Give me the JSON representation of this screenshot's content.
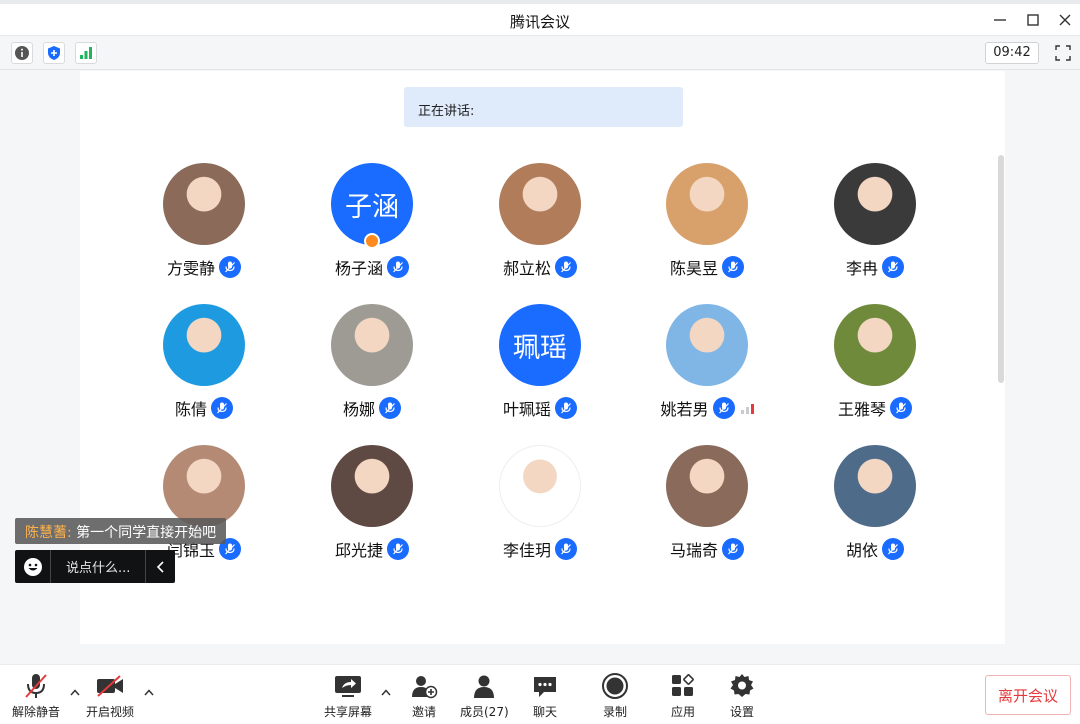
{
  "window": {
    "title": "腾讯会议"
  },
  "toolbar": {
    "clock": "09:42"
  },
  "speaking": {
    "label": "正在讲话:"
  },
  "participants": [
    {
      "name": "方雯静",
      "avatar_type": "photo",
      "avatar_color": "#8b6a5a"
    },
    {
      "name": "杨子涵",
      "avatar_type": "text",
      "avatar_text": "子涵",
      "avatar_color": "#1a6bff",
      "host": true
    },
    {
      "name": "郝立松",
      "avatar_type": "photo",
      "avatar_color": "#b07c5a"
    },
    {
      "name": "陈昊昱",
      "avatar_type": "photo",
      "avatar_color": "#d8a06a"
    },
    {
      "name": "李冉",
      "avatar_type": "photo",
      "avatar_color": "#3a3a3a"
    },
    {
      "name": "陈倩",
      "avatar_type": "photo",
      "avatar_color": "#1e9be0"
    },
    {
      "name": "杨娜",
      "avatar_type": "photo",
      "avatar_color": "#9e9b95"
    },
    {
      "name": "叶珮瑶",
      "avatar_type": "text",
      "avatar_text": "珮瑶",
      "avatar_color": "#1a6bff"
    },
    {
      "name": "姚若男",
      "avatar_type": "photo",
      "avatar_color": "#7fb6e6",
      "signal": true
    },
    {
      "name": "王雅琴",
      "avatar_type": "photo",
      "avatar_color": "#6e8a3a"
    },
    {
      "name": "闫锦玉",
      "avatar_type": "photo",
      "avatar_color": "#b48a74"
    },
    {
      "name": "邱光捷",
      "avatar_type": "photo",
      "avatar_color": "#5e4a42"
    },
    {
      "name": "李佳玥",
      "avatar_type": "photo",
      "avatar_color": "#ffffff"
    },
    {
      "name": "马瑞奇",
      "avatar_type": "photo",
      "avatar_color": "#8a6a5a"
    },
    {
      "name": "胡依",
      "avatar_type": "photo",
      "avatar_color": "#4e6b8a"
    }
  ],
  "chat": {
    "sender": "陈慧蓍:",
    "message": "第一个同学直接开始吧",
    "input_placeholder": "说点什么..."
  },
  "bottombar": {
    "unmute": "解除静音",
    "video": "开启视频",
    "share": "共享屏幕",
    "invite": "邀请",
    "members": "成员(27)",
    "chat": "聊天",
    "record": "录制",
    "apps": "应用",
    "settings": "设置",
    "leave": "离开会议"
  },
  "colors": {
    "accent": "#1a6bff",
    "leave": "#e5393b",
    "host_badge": "#ff8a1f",
    "chat_sender": "#ffb24a"
  }
}
